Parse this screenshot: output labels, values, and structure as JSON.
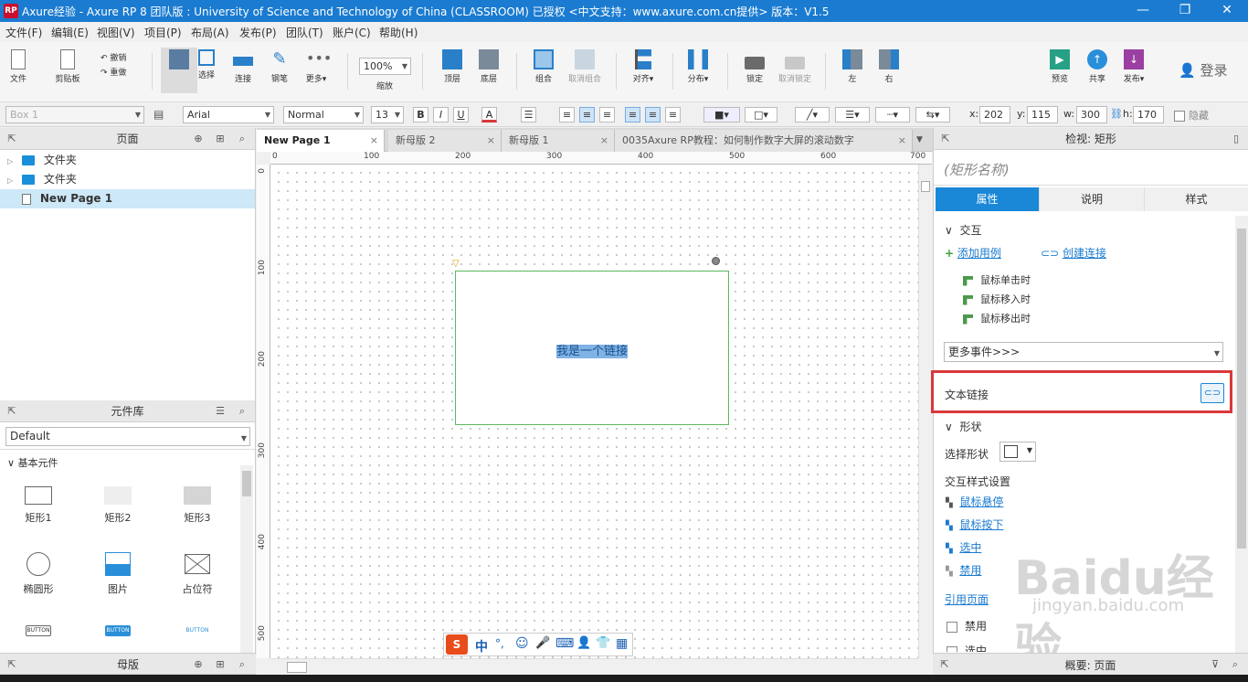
{
  "titlebar": {
    "title": "Axure经验 - Axure RP 8 团队版 : University of Science and Technology of China (CLASSROOM) 已授权     <中文支持：www.axure.com.cn提供> 版本：V1.5",
    "logo": "RP",
    "buttons": [
      "—",
      "❐",
      "✕"
    ]
  },
  "menu": [
    "文件(F)",
    "编辑(E)",
    "视图(V)",
    "项目(P)",
    "布局(A)",
    "发布(P)",
    "团队(T)",
    "账户(C)",
    "帮助(H)"
  ],
  "toolbar": {
    "file": "文件",
    "clipboard": "剪贴板",
    "undo": "撤销",
    "redo": "重做",
    "select": "选择",
    "connect": "连接",
    "pen": "钢笔",
    "more": "更多▾",
    "zoom_value": "100%",
    "zoom": "缩放",
    "top": "顶层",
    "bottom": "底层",
    "group": "组合",
    "ungroup": "取消组合",
    "align": "对齐▾",
    "distribute": "分布▾",
    "lock": "锁定",
    "unlock": "取消锁定",
    "left": "左",
    "right": "右",
    "preview": "预览",
    "share": "共享",
    "publish": "发布▾",
    "login": "登录"
  },
  "format": {
    "widget_name": "Box 1",
    "font": "Arial",
    "style": "Normal",
    "size": "13",
    "bold": "B",
    "italic": "I",
    "underline": "U",
    "textcolor": "A",
    "x_label": "x:",
    "x": "202",
    "y_label": "y:",
    "y": "115",
    "w_label": "w:",
    "w": "300",
    "h_label": "h:",
    "h": "170",
    "hide": "隐藏"
  },
  "pages": {
    "title": "页面",
    "items": [
      {
        "label": "文件夹",
        "type": "folder"
      },
      {
        "label": "文件夹",
        "type": "folder"
      },
      {
        "label": "New Page 1",
        "type": "page",
        "selected": true
      }
    ]
  },
  "library": {
    "title": "元件库",
    "selected": "Default",
    "section": "基本元件",
    "widgets": [
      "矩形1",
      "矩形2",
      "矩形3",
      "椭圆形",
      "图片",
      "占位符",
      "BUTTON",
      "BUTTON",
      "BUTTON"
    ]
  },
  "masters": {
    "title": "母版"
  },
  "tabs": [
    {
      "label": "New Page 1",
      "active": true
    },
    {
      "label": "新母版 2",
      "active": false
    },
    {
      "label": "新母版 1",
      "active": false
    },
    {
      "label": "0035Axure RP教程：如何制作数字大屏的滚动数字",
      "active": false
    }
  ],
  "ruler": {
    "h": [
      "0",
      "100",
      "200",
      "300",
      "400",
      "500",
      "600",
      "700"
    ],
    "v": [
      "0",
      "100",
      "200",
      "300",
      "400",
      "500"
    ]
  },
  "canvas": {
    "rect_text": "我是一个链接"
  },
  "ime": [
    "中",
    "°,",
    "☺",
    "🎤",
    "⌨",
    "👤",
    "👕",
    "▦"
  ],
  "inspector": {
    "title": "检视: 矩形",
    "name_placeholder": "(矩形名称)",
    "tabs": [
      "属性",
      "说明",
      "样式"
    ],
    "interaction": "交互",
    "add_case": "添加用例",
    "create_link": "创建连接",
    "events": [
      "鼠标单击时",
      "鼠标移入时",
      "鼠标移出时"
    ],
    "more_events": "更多事件>>>",
    "text_link": "文本链接",
    "shape": "形状",
    "select_shape": "选择形状",
    "interaction_style": "交互样式设置",
    "styles": [
      "鼠标悬停",
      "鼠标按下",
      "选中",
      "禁用"
    ],
    "ref_page": "引用页面",
    "disabled": "禁用",
    "selected": "选中",
    "summary": "概要: 页面"
  },
  "watermark": "Baidu经验",
  "watermark_sub": "jingyan.baidu.com",
  "colors": {
    "titlebar": "#1a7bd0",
    "accent": "#1a87d7",
    "highlight": "#d9383a"
  }
}
